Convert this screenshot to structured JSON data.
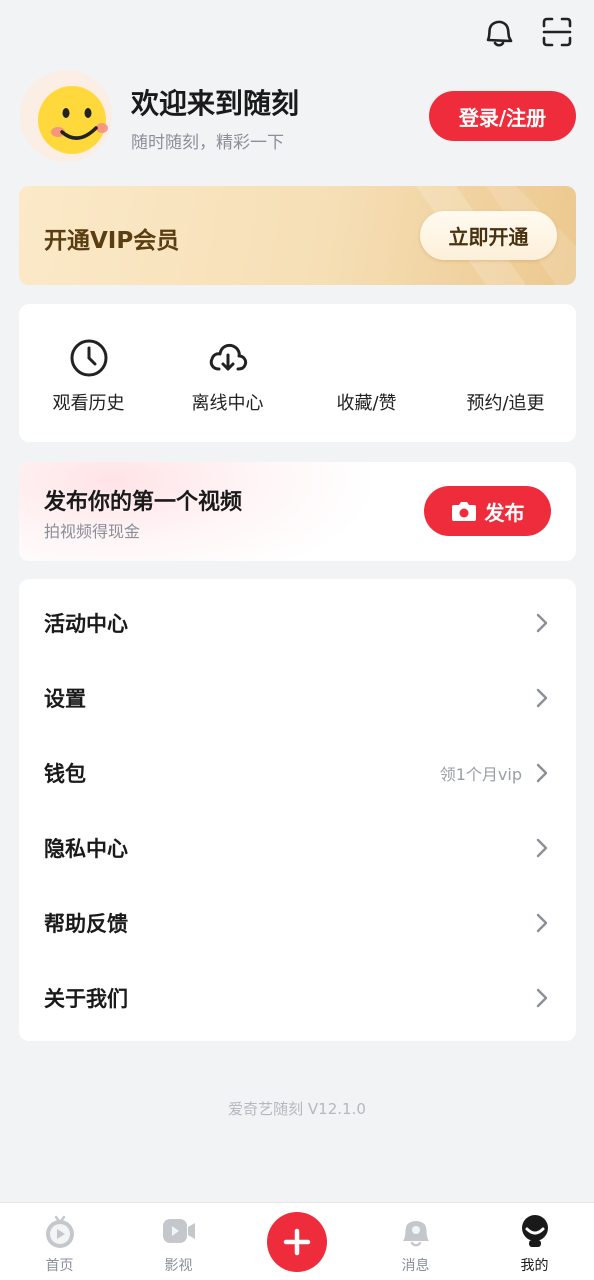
{
  "colors": {
    "accent": "#ee2c3c",
    "vip_text": "#5a3d12",
    "background": "#f2f3f5"
  },
  "topbar": {
    "icons": [
      "bell-icon",
      "scan-icon"
    ]
  },
  "profile": {
    "welcome": "欢迎来到随刻",
    "subtitle": "随时随刻，精彩一下",
    "login_label": "登录/注册"
  },
  "vip": {
    "title": "开通VIP会员",
    "button_label": "立即开通"
  },
  "quick_actions": [
    {
      "label": "观看历史",
      "icon": "clock-icon"
    },
    {
      "label": "离线中心",
      "icon": "cloud-download-icon"
    },
    {
      "label": "收藏/赞",
      "icon": ""
    },
    {
      "label": "预约/追更",
      "icon": ""
    }
  ],
  "publish": {
    "title": "发布你的第一个视频",
    "subtitle": "拍视频得现金",
    "button_label": "发布",
    "button_icon": "camera-icon"
  },
  "menu": [
    {
      "label": "活动中心",
      "hint": ""
    },
    {
      "label": "设置",
      "hint": ""
    },
    {
      "label": "钱包",
      "hint": "领1个月vip"
    },
    {
      "label": "隐私中心",
      "hint": ""
    },
    {
      "label": "帮助反馈",
      "hint": ""
    },
    {
      "label": "关于我们",
      "hint": ""
    }
  ],
  "version": "爱奇艺随刻 V12.1.0",
  "tabbar": [
    {
      "label": "首页",
      "icon": "home-tv-icon",
      "active": false
    },
    {
      "label": "影视",
      "icon": "video-camera-icon",
      "active": false
    },
    {
      "label": "",
      "icon": "plus-icon",
      "active": false
    },
    {
      "label": "消息",
      "icon": "message-bell-icon",
      "active": false
    },
    {
      "label": "我的",
      "icon": "profile-icon",
      "active": true
    }
  ]
}
